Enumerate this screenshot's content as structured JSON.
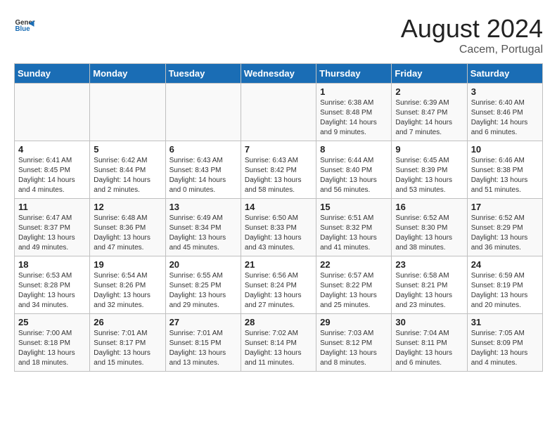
{
  "header": {
    "logo_general": "General",
    "logo_blue": "Blue",
    "title": "August 2024",
    "subtitle": "Cacem, Portugal"
  },
  "calendar": {
    "days_of_week": [
      "Sunday",
      "Monday",
      "Tuesday",
      "Wednesday",
      "Thursday",
      "Friday",
      "Saturday"
    ],
    "weeks": [
      [
        {
          "day": "",
          "info": ""
        },
        {
          "day": "",
          "info": ""
        },
        {
          "day": "",
          "info": ""
        },
        {
          "day": "",
          "info": ""
        },
        {
          "day": "1",
          "info": "Sunrise: 6:38 AM\nSunset: 8:48 PM\nDaylight: 14 hours and 9 minutes."
        },
        {
          "day": "2",
          "info": "Sunrise: 6:39 AM\nSunset: 8:47 PM\nDaylight: 14 hours and 7 minutes."
        },
        {
          "day": "3",
          "info": "Sunrise: 6:40 AM\nSunset: 8:46 PM\nDaylight: 14 hours and 6 minutes."
        }
      ],
      [
        {
          "day": "4",
          "info": "Sunrise: 6:41 AM\nSunset: 8:45 PM\nDaylight: 14 hours and 4 minutes."
        },
        {
          "day": "5",
          "info": "Sunrise: 6:42 AM\nSunset: 8:44 PM\nDaylight: 14 hours and 2 minutes."
        },
        {
          "day": "6",
          "info": "Sunrise: 6:43 AM\nSunset: 8:43 PM\nDaylight: 14 hours and 0 minutes."
        },
        {
          "day": "7",
          "info": "Sunrise: 6:43 AM\nSunset: 8:42 PM\nDaylight: 13 hours and 58 minutes."
        },
        {
          "day": "8",
          "info": "Sunrise: 6:44 AM\nSunset: 8:40 PM\nDaylight: 13 hours and 56 minutes."
        },
        {
          "day": "9",
          "info": "Sunrise: 6:45 AM\nSunset: 8:39 PM\nDaylight: 13 hours and 53 minutes."
        },
        {
          "day": "10",
          "info": "Sunrise: 6:46 AM\nSunset: 8:38 PM\nDaylight: 13 hours and 51 minutes."
        }
      ],
      [
        {
          "day": "11",
          "info": "Sunrise: 6:47 AM\nSunset: 8:37 PM\nDaylight: 13 hours and 49 minutes."
        },
        {
          "day": "12",
          "info": "Sunrise: 6:48 AM\nSunset: 8:36 PM\nDaylight: 13 hours and 47 minutes."
        },
        {
          "day": "13",
          "info": "Sunrise: 6:49 AM\nSunset: 8:34 PM\nDaylight: 13 hours and 45 minutes."
        },
        {
          "day": "14",
          "info": "Sunrise: 6:50 AM\nSunset: 8:33 PM\nDaylight: 13 hours and 43 minutes."
        },
        {
          "day": "15",
          "info": "Sunrise: 6:51 AM\nSunset: 8:32 PM\nDaylight: 13 hours and 41 minutes."
        },
        {
          "day": "16",
          "info": "Sunrise: 6:52 AM\nSunset: 8:30 PM\nDaylight: 13 hours and 38 minutes."
        },
        {
          "day": "17",
          "info": "Sunrise: 6:52 AM\nSunset: 8:29 PM\nDaylight: 13 hours and 36 minutes."
        }
      ],
      [
        {
          "day": "18",
          "info": "Sunrise: 6:53 AM\nSunset: 8:28 PM\nDaylight: 13 hours and 34 minutes."
        },
        {
          "day": "19",
          "info": "Sunrise: 6:54 AM\nSunset: 8:26 PM\nDaylight: 13 hours and 32 minutes."
        },
        {
          "day": "20",
          "info": "Sunrise: 6:55 AM\nSunset: 8:25 PM\nDaylight: 13 hours and 29 minutes."
        },
        {
          "day": "21",
          "info": "Sunrise: 6:56 AM\nSunset: 8:24 PM\nDaylight: 13 hours and 27 minutes."
        },
        {
          "day": "22",
          "info": "Sunrise: 6:57 AM\nSunset: 8:22 PM\nDaylight: 13 hours and 25 minutes."
        },
        {
          "day": "23",
          "info": "Sunrise: 6:58 AM\nSunset: 8:21 PM\nDaylight: 13 hours and 23 minutes."
        },
        {
          "day": "24",
          "info": "Sunrise: 6:59 AM\nSunset: 8:19 PM\nDaylight: 13 hours and 20 minutes."
        }
      ],
      [
        {
          "day": "25",
          "info": "Sunrise: 7:00 AM\nSunset: 8:18 PM\nDaylight: 13 hours and 18 minutes."
        },
        {
          "day": "26",
          "info": "Sunrise: 7:01 AM\nSunset: 8:17 PM\nDaylight: 13 hours and 15 minutes."
        },
        {
          "day": "27",
          "info": "Sunrise: 7:01 AM\nSunset: 8:15 PM\nDaylight: 13 hours and 13 minutes."
        },
        {
          "day": "28",
          "info": "Sunrise: 7:02 AM\nSunset: 8:14 PM\nDaylight: 13 hours and 11 minutes."
        },
        {
          "day": "29",
          "info": "Sunrise: 7:03 AM\nSunset: 8:12 PM\nDaylight: 13 hours and 8 minutes."
        },
        {
          "day": "30",
          "info": "Sunrise: 7:04 AM\nSunset: 8:11 PM\nDaylight: 13 hours and 6 minutes."
        },
        {
          "day": "31",
          "info": "Sunrise: 7:05 AM\nSunset: 8:09 PM\nDaylight: 13 hours and 4 minutes."
        }
      ]
    ]
  }
}
